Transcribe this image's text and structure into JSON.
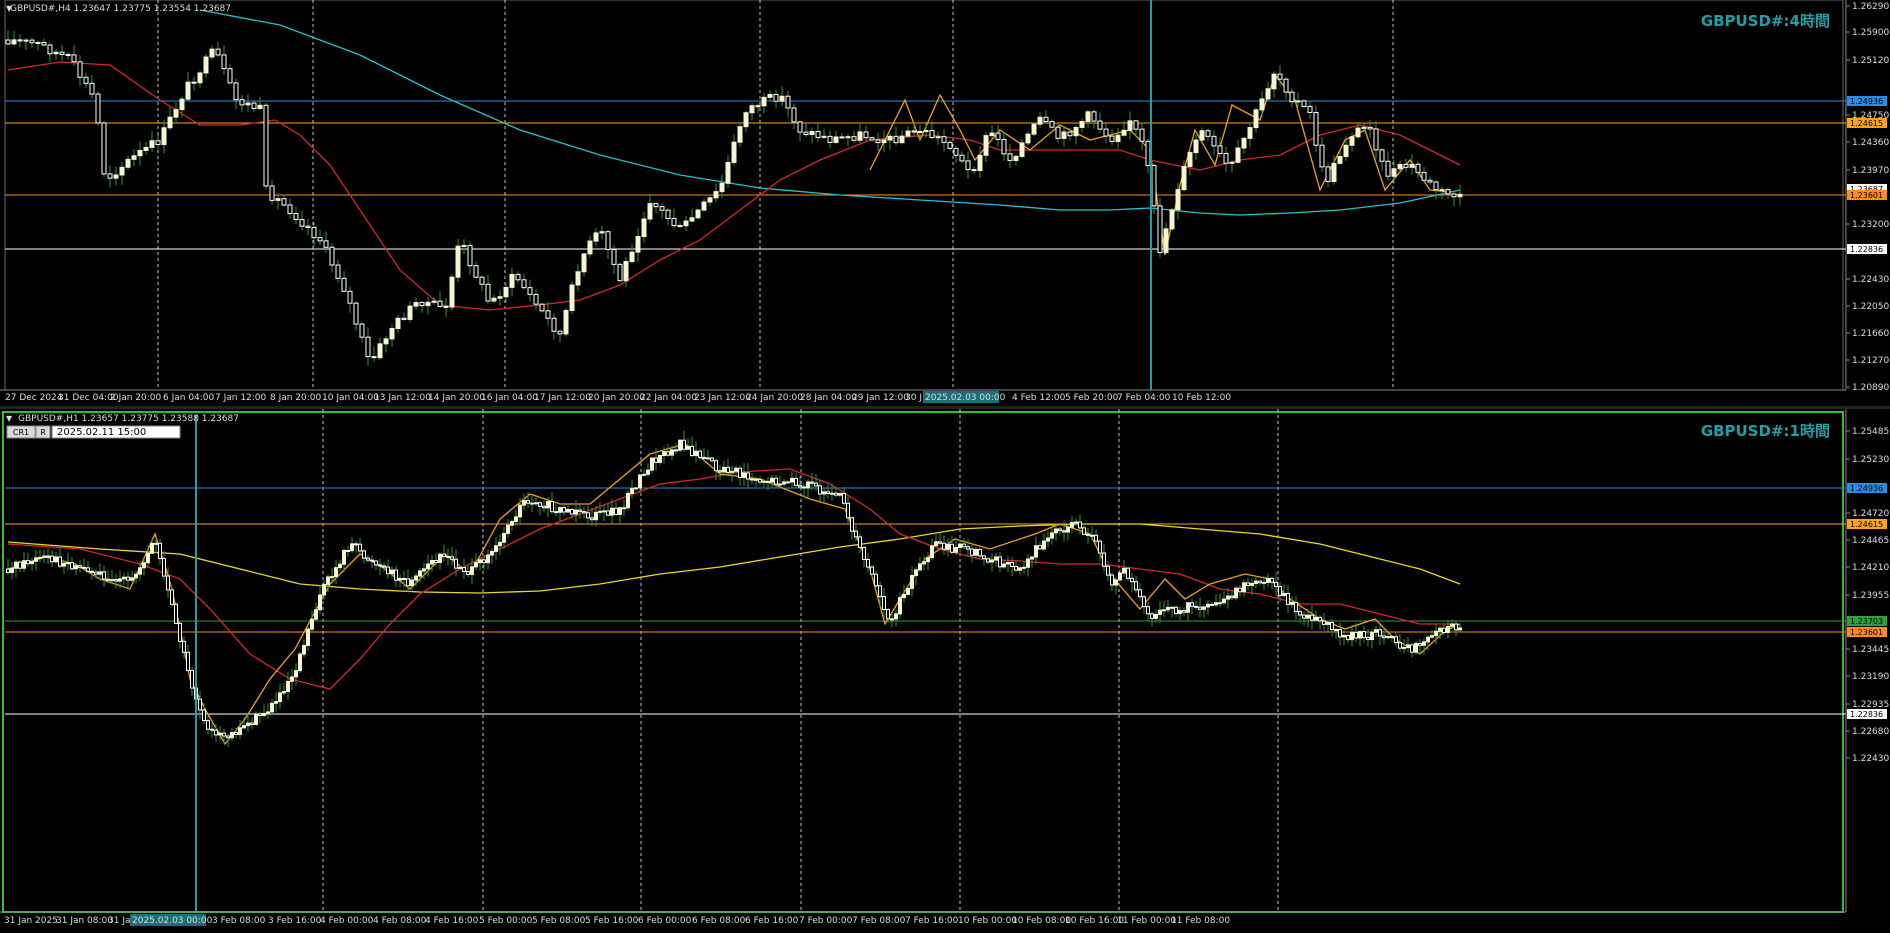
{
  "colors": {
    "background": "#000000",
    "grid": "#c8c8c8",
    "candle_up": "#f5f5d0",
    "candle_down": "#ffffff",
    "wick": "#2e9a3a",
    "ma_fast": "#d8262b",
    "ma_slow_h4": "#29c2cf",
    "ma_slow_h1": "#e8d92b",
    "zigzag": "#f0a020",
    "level_blue": "#2b8ae2",
    "level_orange": "#ffa21a",
    "level_orange2": "#ff8c1a",
    "level_white": "#ffffff",
    "title_accent": "#1ea0a8",
    "border_green": "#30c030"
  },
  "top": {
    "header": "GBPUSD#,H4  1.23647 1.23775 1.23554 1.23687",
    "title": "GBPUSD#:4時間",
    "price_ticks": [
      "1.26290",
      "1.25900",
      "1.25120",
      "1.24750",
      "1.24360",
      "1.23970",
      "1.23200",
      "1.22430",
      "1.22050",
      "1.21660",
      "1.21270",
      "1.20890"
    ],
    "price_labels": [
      {
        "text": "1.24936",
        "kind": "blue"
      },
      {
        "text": "1.24615",
        "kind": "orange"
      },
      {
        "text": "1.23687",
        "kind": "white"
      },
      {
        "text": "1.23601",
        "kind": "orange2"
      },
      {
        "text": "1.22836",
        "kind": "white"
      }
    ],
    "time_labels": [
      "27 Dec 2024",
      "31 Dec 04:00",
      "2 Jan 20:00",
      "6 Jan 04:00",
      "7 Jan 12:00",
      "8 Jan 20:00",
      "10 Jan 04:00",
      "13 Jan 12:00",
      "14 Jan 20:00",
      "16 Jan 04:00",
      "17 Jan 12:00",
      "20 Jan 20:00",
      "22 Jan 04:00",
      "23 Jan 12:00",
      "24 Jan 20:00",
      "28 Jan 04:00",
      "29 Jan 12:00",
      "30 J",
      "2025.02.03 00:00",
      "4 Feb 12:00",
      "5 Feb 20:00",
      "7 Feb 04:00",
      "10 Feb 12:00"
    ]
  },
  "bottom": {
    "header": "GBPUSD#,H1  1.23657 1.23775 1.23588 1.23687",
    "title": "GBPUSD#:1時間",
    "toolbar_cr": "CR1",
    "toolbar_r": "R",
    "toolbar_date": "2025.02.11 15:00",
    "price_ticks": [
      "1.25485",
      "1.25230",
      "1.24720",
      "1.24465",
      "1.24210",
      "1.23955",
      "1.23445",
      "1.23190",
      "1.22935",
      "1.22680",
      "1.22430"
    ],
    "price_labels": [
      {
        "text": "1.24936",
        "kind": "blue"
      },
      {
        "text": "1.24615",
        "kind": "orange"
      },
      {
        "text": "1.23703",
        "kind": "green"
      },
      {
        "text": "1.23601",
        "kind": "orange2"
      },
      {
        "text": "1.22836",
        "kind": "white"
      }
    ],
    "time_labels": [
      "31 Jan 2025",
      "31 Jan 08:00",
      "31 Jan",
      "2025.02.03 00:00",
      "3 Feb 08:00",
      "3 Feb 16:00",
      "4 Feb 00:00",
      "4 Feb 08:00",
      "4 Feb 16:00",
      "5 Feb 00:00",
      "5 Feb 08:00",
      "5 Feb 16:00",
      "6 Feb 00:00",
      "6 Feb 08:00",
      "6 Feb 16:00",
      "7 Feb 00:00",
      "7 Feb 08:00",
      "7 Feb 16:00",
      "10 Feb 00:00",
      "10 Feb 08:00",
      "10 Feb 16:00",
      "11 Feb 00:00",
      "11 Feb 08:00"
    ]
  }
}
